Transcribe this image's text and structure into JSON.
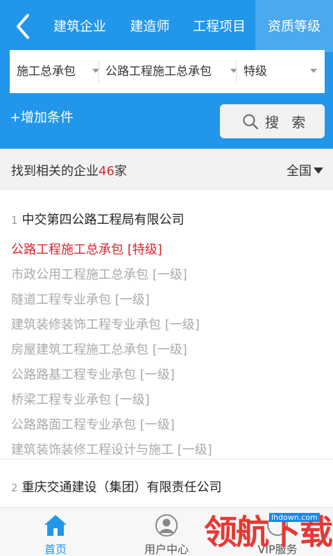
{
  "nav": {
    "tabs": [
      {
        "label": "建筑企业"
      },
      {
        "label": "建造师"
      },
      {
        "label": "工程项目"
      },
      {
        "label": "资质等级"
      }
    ],
    "active_tab": "资质等级"
  },
  "filters": [
    {
      "value": "施工总承包"
    },
    {
      "value": "公路工程施工总承包"
    },
    {
      "value": "特级"
    }
  ],
  "add_condition_label": "+增加条件",
  "search_label": "搜 索",
  "summary": {
    "prefix": "找到相关的企业",
    "count": "46",
    "suffix": "家",
    "region": "全国"
  },
  "results": [
    {
      "index": "1",
      "name": "中交第四公路工程局有限公司",
      "qualifications": [
        {
          "text": "公路工程施工总承包 [特级]",
          "highlight": true
        },
        {
          "text": "市政公用工程施工总承包 [一级]",
          "highlight": false
        },
        {
          "text": "隧道工程专业承包 [一级]",
          "highlight": false
        },
        {
          "text": "建筑装修装饰工程专业承包 [一级]",
          "highlight": false
        },
        {
          "text": "房屋建筑工程施工总承包 [一级]",
          "highlight": false
        },
        {
          "text": "公路路基工程专业承包 [一级]",
          "highlight": false
        },
        {
          "text": "桥梁工程专业承包 [一级]",
          "highlight": false
        },
        {
          "text": "公路路面工程专业承包 [一级]",
          "highlight": false
        },
        {
          "text": "建筑装饰装修工程设计与施工 [一级]",
          "highlight": false
        }
      ]
    },
    {
      "index": "2",
      "name": "重庆交通建设（集团）有限责任公司",
      "qualifications": []
    }
  ],
  "bottom_tabs": [
    {
      "label": "首页",
      "icon": "home-icon",
      "active": true
    },
    {
      "label": "用户中心",
      "icon": "user-icon",
      "active": false
    },
    {
      "label": "VIP服务",
      "icon": "vip-icon",
      "active": false
    }
  ],
  "colors": {
    "primary": "#2196ea",
    "active_tab_bg": "#4ba9ef",
    "highlight_red": "#d9252b",
    "muted_text": "#aaaaaa"
  },
  "watermark": {
    "text": "领航下载",
    "site": "lhdown.com"
  }
}
